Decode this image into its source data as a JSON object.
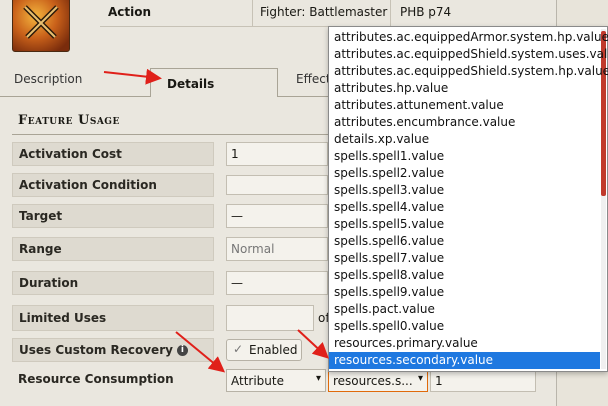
{
  "header": {
    "activation_type": "Action",
    "class_requirement": "Fighter: Battlemaster",
    "source": "PHB p74"
  },
  "tabs": [
    {
      "label": "Description"
    },
    {
      "label": "Details"
    },
    {
      "label": "Effect"
    }
  ],
  "section": {
    "title": "Feature Usage"
  },
  "rows": {
    "activation_cost": {
      "label": "Activation Cost",
      "value": "1"
    },
    "activation_condition": {
      "label": "Activation Condition",
      "value": ""
    },
    "target": {
      "label": "Target",
      "value": "—"
    },
    "range": {
      "label": "Range",
      "value": "Normal"
    },
    "duration": {
      "label": "Duration",
      "value": "—"
    },
    "limited_uses": {
      "label": "Limited Uses",
      "value": "",
      "of": "of"
    },
    "custom_recovery": {
      "label": "Uses Custom Recovery",
      "info": "i",
      "toggle_label": "Enabled",
      "checkmark": "✓"
    },
    "resource_consumption": {
      "label": "Resource Consumption",
      "type": "Attribute",
      "target": "resources.s...",
      "amount": "1"
    }
  },
  "dropdown": {
    "options": [
      "attributes.ac.equippedArmor.system.hp.value",
      "attributes.ac.equippedShield.system.uses.value",
      "attributes.ac.equippedShield.system.hp.value",
      "attributes.hp.value",
      "attributes.attunement.value",
      "attributes.encumbrance.value",
      "details.xp.value",
      "spells.spell1.value",
      "spells.spell2.value",
      "spells.spell3.value",
      "spells.spell4.value",
      "spells.spell5.value",
      "spells.spell6.value",
      "spells.spell7.value",
      "spells.spell8.value",
      "spells.spell9.value",
      "spells.pact.value",
      "spells.spell0.value",
      "resources.primary.value",
      "resources.secondary.value"
    ],
    "selected": "resources.secondary.value"
  },
  "colors": {
    "accent": "#1e78e0",
    "annotation_arrow": "#e0201a",
    "focus_border": "#e06a0a"
  }
}
